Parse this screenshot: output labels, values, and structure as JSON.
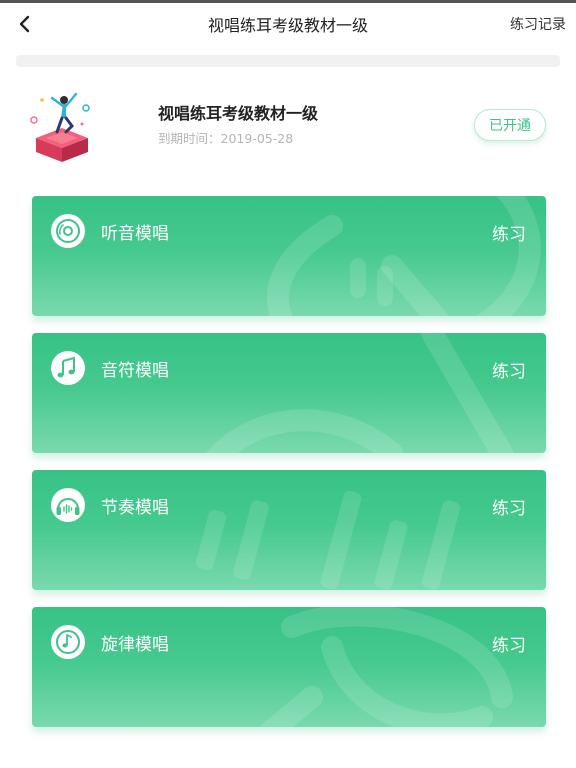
{
  "header": {
    "title": "视唱练耳考级教材一级",
    "record_label": "练习记录"
  },
  "course": {
    "name": "视唱练耳考级教材一级",
    "expire_text": "到期时间：2019-05-28",
    "status_badge": "已开通"
  },
  "cards": [
    {
      "label": "听音模唱",
      "action": "练习",
      "icon": "disc-icon"
    },
    {
      "label": "音符模唱",
      "action": "练习",
      "icon": "music-note-icon"
    },
    {
      "label": "节奏模唱",
      "action": "练习",
      "icon": "headphones-icon"
    },
    {
      "label": "旋律模唱",
      "action": "练习",
      "icon": "melody-disc-icon"
    }
  ],
  "colors": {
    "accent": "#3ec28a",
    "card_top": "#37c286",
    "card_bottom": "#7ad9ae"
  }
}
